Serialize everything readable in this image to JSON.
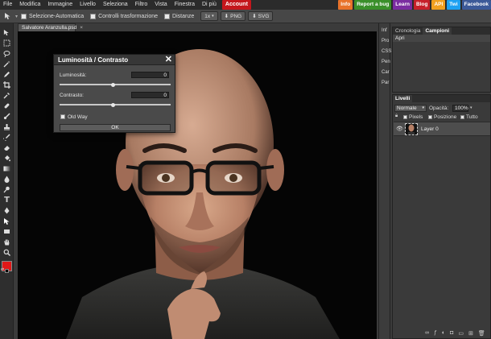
{
  "menubar": {
    "items": [
      "File",
      "Modifica",
      "Immagine",
      "Livello",
      "Seleziona",
      "Filtro",
      "Vista",
      "Finestra",
      "Di più"
    ],
    "account": "Account",
    "right_buttons": [
      {
        "label": "Info",
        "color": "#e8722a"
      },
      {
        "label": "Report a bug",
        "color": "#3a8f2a"
      },
      {
        "label": "Learn",
        "color": "#7a2ca0"
      },
      {
        "label": "Blog",
        "color": "#c6202a"
      },
      {
        "label": "API",
        "color": "#f0a020"
      },
      {
        "label": "Twi",
        "color": "#1da1f2"
      },
      {
        "label": "Facebook",
        "color": "#3b5998"
      }
    ]
  },
  "options": {
    "auto_select": "Selezione-Automatica",
    "transform_controls": "Controlli trasformazione",
    "distances": "Distanze",
    "zoom": "1x",
    "png": "PNG",
    "svg": "SVG"
  },
  "document": {
    "tab_name": "Salvatore Aranzulla.psd"
  },
  "dialog": {
    "title": "Luminosità / Contrasto",
    "brightness_label": "Luminosità:",
    "brightness_value": "0",
    "contrast_label": "Contrasto:",
    "contrast_value": "0",
    "old_way": "Old Way",
    "ok": "OK"
  },
  "collapsed_panel": [
    "Inf",
    "Pro",
    "CSS",
    "Pen",
    "Car",
    "Par"
  ],
  "history": {
    "tabs": [
      "Cronologia",
      "Campioni"
    ],
    "items": [
      "Apri"
    ]
  },
  "layers": {
    "title": "Livelli",
    "blend_mode": "Normale",
    "opacity_label": "Opacità:",
    "opacity_value": "100%",
    "lock_pixels": "Pixels",
    "lock_position": "Posizione",
    "lock_all": "Tutto",
    "layer_name": "Layer 0"
  },
  "colors": {
    "foreground": "#e01818",
    "background": "#000000"
  }
}
